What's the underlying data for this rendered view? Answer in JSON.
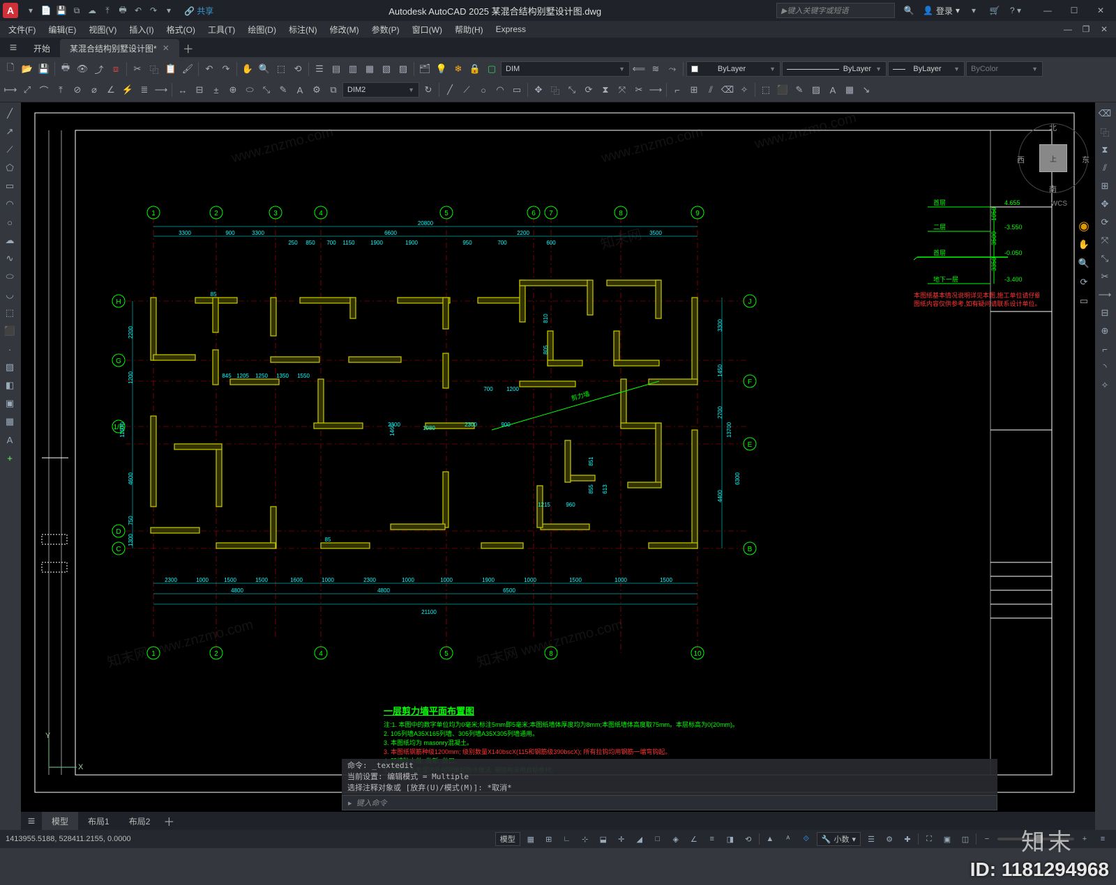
{
  "titlebar": {
    "app_letter": "A",
    "share": "共享",
    "title": "Autodesk AutoCAD 2025    某混合结构别墅设计图.dwg",
    "search_placeholder": "键入关键字或短语",
    "login": "登录"
  },
  "menus": [
    "文件(F)",
    "编辑(E)",
    "视图(V)",
    "插入(I)",
    "格式(O)",
    "工具(T)",
    "绘图(D)",
    "标注(N)",
    "修改(M)",
    "参数(P)",
    "窗口(W)",
    "帮助(H)",
    "Express"
  ],
  "doctabs": {
    "start": "开始",
    "active": "某混合结构别墅设计图*"
  },
  "ribbon": {
    "dim_combo1": "DIM",
    "layer_combo": "ByLayer",
    "linetype": "ByLayer",
    "lineweight": "ByLayer",
    "color": "ByColor",
    "dim_combo2": "DIM2"
  },
  "viewcube": {
    "n": "北",
    "s": "南",
    "e": "东",
    "w": "西",
    "top": "上",
    "wcs": "WCS"
  },
  "ucs": {
    "x": "X",
    "y": "Y"
  },
  "grid_top_nums": [
    "1",
    "2",
    "3",
    "4",
    "5",
    "6",
    "7",
    "8",
    "9"
  ],
  "grid_bot_nums": [
    "1",
    "2",
    "4",
    "5",
    "8",
    "10"
  ],
  "grid_left": [
    "H",
    "G",
    "1/E",
    "D",
    "C"
  ],
  "grid_right": [
    "J",
    "F",
    "E",
    "B"
  ],
  "dims": {
    "overall_top": "20800",
    "top_seg": [
      "3300",
      "900",
      "3300",
      "250",
      "850",
      "700",
      "6600",
      "1150",
      "1900",
      "1900",
      "950",
      "700",
      "2200",
      "600",
      "3500"
    ],
    "overall_bot": "21100",
    "bot_row1": [
      "2300",
      "1000",
      "1500",
      "1500",
      "1600",
      "1000",
      "2300",
      "1000",
      "1000",
      "1900",
      "1000",
      "1500",
      "1000",
      "1500"
    ],
    "bot_row2": [
      "4800",
      "4800",
      "6500"
    ],
    "left": [
      "2200",
      "1200",
      "11500",
      "4600",
      "750",
      "1300"
    ],
    "right": [
      "3300",
      "1450",
      "2700",
      "13700",
      "4400",
      "6300"
    ],
    "inner": [
      "845",
      "1205",
      "1250",
      "1350",
      "1550",
      "85",
      "85",
      "700",
      "1200",
      "1215",
      "960",
      "851",
      "855",
      "613",
      "810",
      "805",
      "1460",
      "1980",
      "2300",
      "2300",
      "900"
    ]
  },
  "drawing": {
    "title": "一层剪力墙平面布置图",
    "notes1": "注:1. 本图中的数字单位均为0毫米;标注5mm即5毫米;本图纸墙体厚度均为8mm;本图纸墙体高度取75mm。本层标高为0(20mm)。",
    "notes2": "2. 105列墙A35X165列墙、305列墙A35X305列墙通用。",
    "notes3": "3. 本图纸均为 masonry混凝土。",
    "notes4": "3. 本图纸钢筋种级1200mm; 级别数量X140bscX(115和钢筋级390bscX); 所有拉钩均用钢筋一端弯钩起。",
    "notes5": "4. 凹槽防水做□做新□做口。",
    "notes6": "5. 凹槽防水处理内外相同做起防水做法; 据结构采用自粘卷材。"
  },
  "elev": {
    "l1": "首层",
    "l1v": "4.655",
    "l2": "二层",
    "l2v": "-3.550",
    "l3": "首层",
    "l3v": "-0.050",
    "l4": "地下一层",
    "l4v": "-3.400",
    "d1": "1050",
    "d2": "3500",
    "d3": "3350"
  },
  "cmd": {
    "h1": "命令: _textedit",
    "h2": "当前设置: 编辑模式 = Multiple",
    "h3": "选择注释对象或  [放弃(U)/模式(M)]: *取消*",
    "prompt": "键入命令"
  },
  "bottom_tabs": [
    "模型",
    "布局1",
    "布局2"
  ],
  "status": {
    "coords": "1413955.5188, 528411.2155, 0.0000",
    "model": "模型",
    "decimal": "小数"
  },
  "overlay": {
    "brand": "知末",
    "id": "ID: 1181294968"
  }
}
